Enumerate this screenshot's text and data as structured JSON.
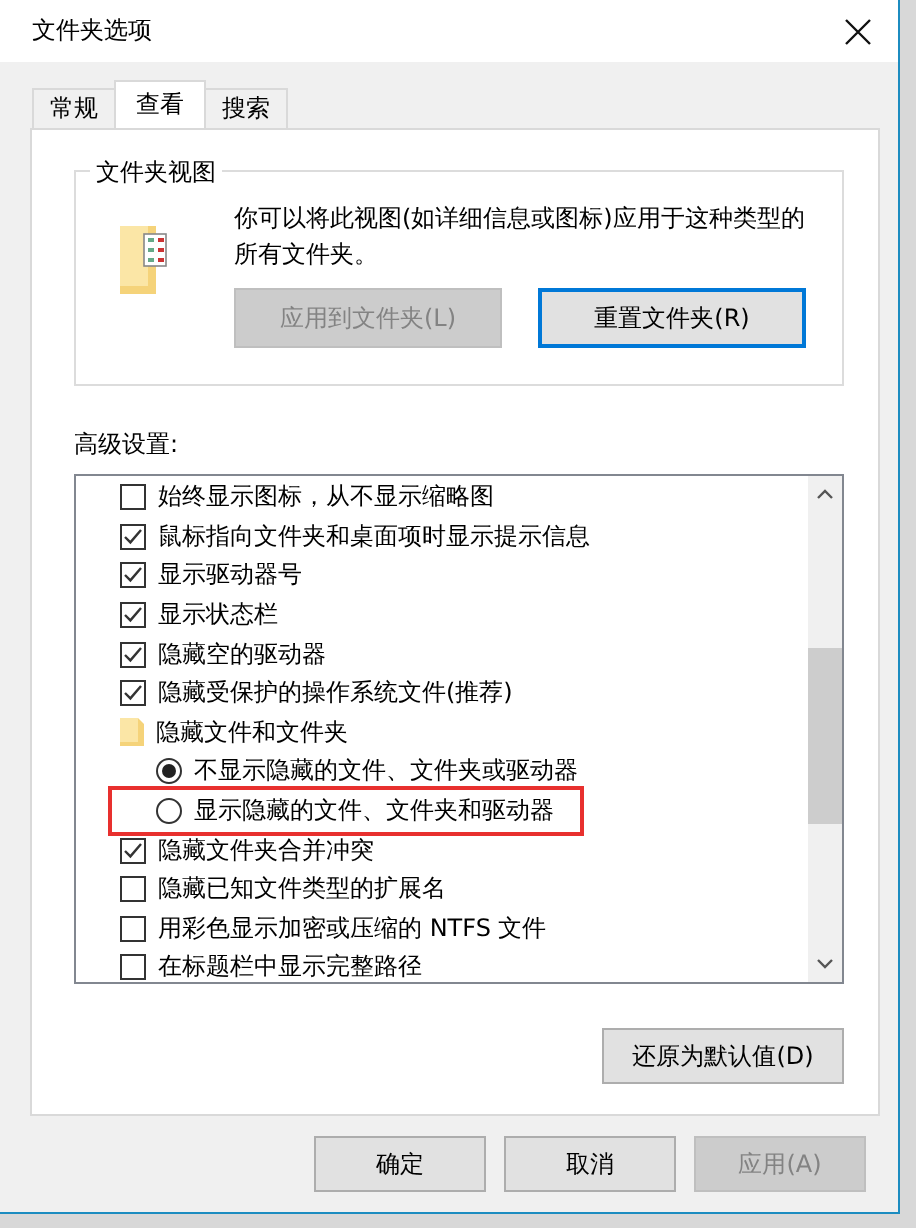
{
  "window": {
    "title": "文件夹选项"
  },
  "tabs": [
    {
      "label": "常规",
      "selected": false
    },
    {
      "label": "查看",
      "selected": true
    },
    {
      "label": "搜索",
      "selected": false
    }
  ],
  "folder_views": {
    "title": "文件夹视图",
    "description": "你可以将此视图(如详细信息或图标)应用于这种类型的所有文件夹。",
    "buttons": [
      {
        "label": "应用到文件夹(L)",
        "disabled": true,
        "focused": false
      },
      {
        "label": "重置文件夹(R)",
        "disabled": false,
        "focused": true
      }
    ]
  },
  "advanced": {
    "label": "高级设置:",
    "items": [
      {
        "kind": "checkbox",
        "label": "始终显示图标，从不显示缩略图",
        "checked": false
      },
      {
        "kind": "checkbox",
        "label": "鼠标指向文件夹和桌面项时显示提示信息",
        "checked": true
      },
      {
        "kind": "checkbox",
        "label": "显示驱动器号",
        "checked": true
      },
      {
        "kind": "checkbox",
        "label": "显示状态栏",
        "checked": true
      },
      {
        "kind": "checkbox",
        "label": "隐藏空的驱动器",
        "checked": true
      },
      {
        "kind": "checkbox",
        "label": "隐藏受保护的操作系统文件(推荐)",
        "checked": true
      },
      {
        "kind": "folder",
        "label": "隐藏文件和文件夹"
      },
      {
        "kind": "radio",
        "label": "不显示隐藏的文件、文件夹或驱动器",
        "selected": true
      },
      {
        "kind": "radio",
        "label": "显示隐藏的文件、文件夹和驱动器",
        "selected": false,
        "highlighted": true
      },
      {
        "kind": "checkbox",
        "label": "隐藏文件夹合并冲突",
        "checked": true
      },
      {
        "kind": "checkbox",
        "label": "隐藏已知文件类型的扩展名",
        "checked": false
      },
      {
        "kind": "checkbox",
        "label": "用彩色显示加密或压缩的 NTFS 文件",
        "checked": false
      },
      {
        "kind": "checkbox",
        "label": "在标题栏中显示完整路径",
        "checked": false
      }
    ],
    "restore_button": "还原为默认值(D)"
  },
  "buttons": [
    {
      "label": "确定",
      "disabled": false
    },
    {
      "label": "取消",
      "disabled": false
    },
    {
      "label": "应用(A)",
      "disabled": true
    }
  ]
}
